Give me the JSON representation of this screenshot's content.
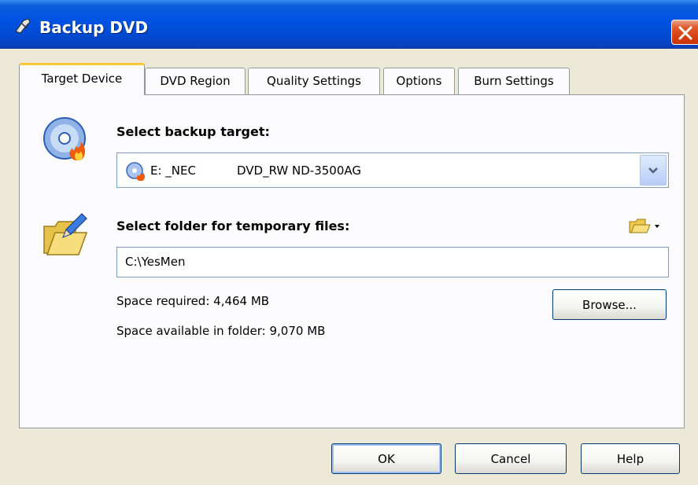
{
  "window": {
    "title": "Backup DVD",
    "title_icon": "dvd-tool-icon",
    "close_icon": "close-icon"
  },
  "tabs": [
    {
      "label": "Target Device",
      "active": true
    },
    {
      "label": "DVD Region",
      "active": false
    },
    {
      "label": "Quality Settings",
      "active": false
    },
    {
      "label": "Options",
      "active": false
    },
    {
      "label": "Burn Settings",
      "active": false
    }
  ],
  "target": {
    "heading": "Select backup target:",
    "icon": "dvd-burn-icon",
    "drive_letter": "E: _NEC",
    "drive_name": "DVD_RW ND-3500AG"
  },
  "temp": {
    "heading": "Select folder for temporary files:",
    "icon": "open-folder-icon",
    "path": "C:\\YesMen",
    "space_required": "Space required:  4,464 MB",
    "space_available": "Space available in folder:  9,070 MB",
    "browse_label": "Browse..."
  },
  "buttons": {
    "ok": "OK",
    "cancel": "Cancel",
    "help": "Help"
  },
  "colors": {
    "titlebar": "#0054e3",
    "tab_highlight": "#ffc83c",
    "close": "#d63f10"
  }
}
